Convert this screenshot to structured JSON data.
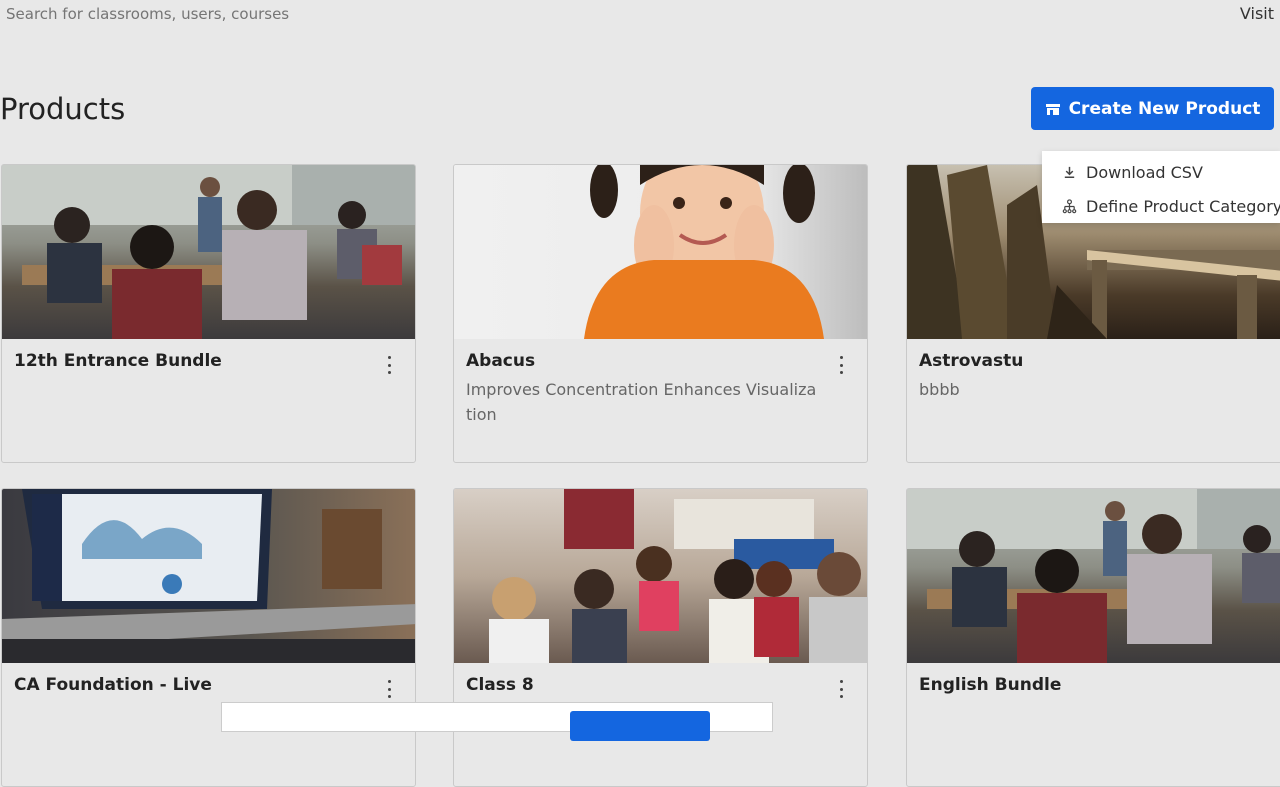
{
  "search": {
    "placeholder": "Search for classrooms, users, courses"
  },
  "header": {
    "visit_label": "Visit"
  },
  "page": {
    "title": "Products"
  },
  "toolbar": {
    "create_label": "Create New Product"
  },
  "menu": {
    "items": [
      {
        "label": "Download CSV",
        "icon": "download-icon"
      },
      {
        "label": "Define Product Category",
        "icon": "hierarchy-icon"
      }
    ]
  },
  "products": [
    {
      "title": "12th Entrance Bundle",
      "description": "",
      "image": "classroom-photo"
    },
    {
      "title": "Abacus",
      "description": "Improves Concentration Enhances Visualization",
      "image": "girl-portrait-photo"
    },
    {
      "title": "Astrovastu",
      "description": "bbbb",
      "image": "bridge-forest-photo"
    },
    {
      "title": "CA Foundation - Live",
      "description": "",
      "image": "laptop-dashboard-photo"
    },
    {
      "title": "Class 8",
      "description": "",
      "image": "kids-classroom-photo"
    },
    {
      "title": "English Bundle",
      "description": "",
      "image": "classroom-photo"
    }
  ],
  "colors": {
    "accent": "#1466e0",
    "background": "#e8e8e8"
  }
}
